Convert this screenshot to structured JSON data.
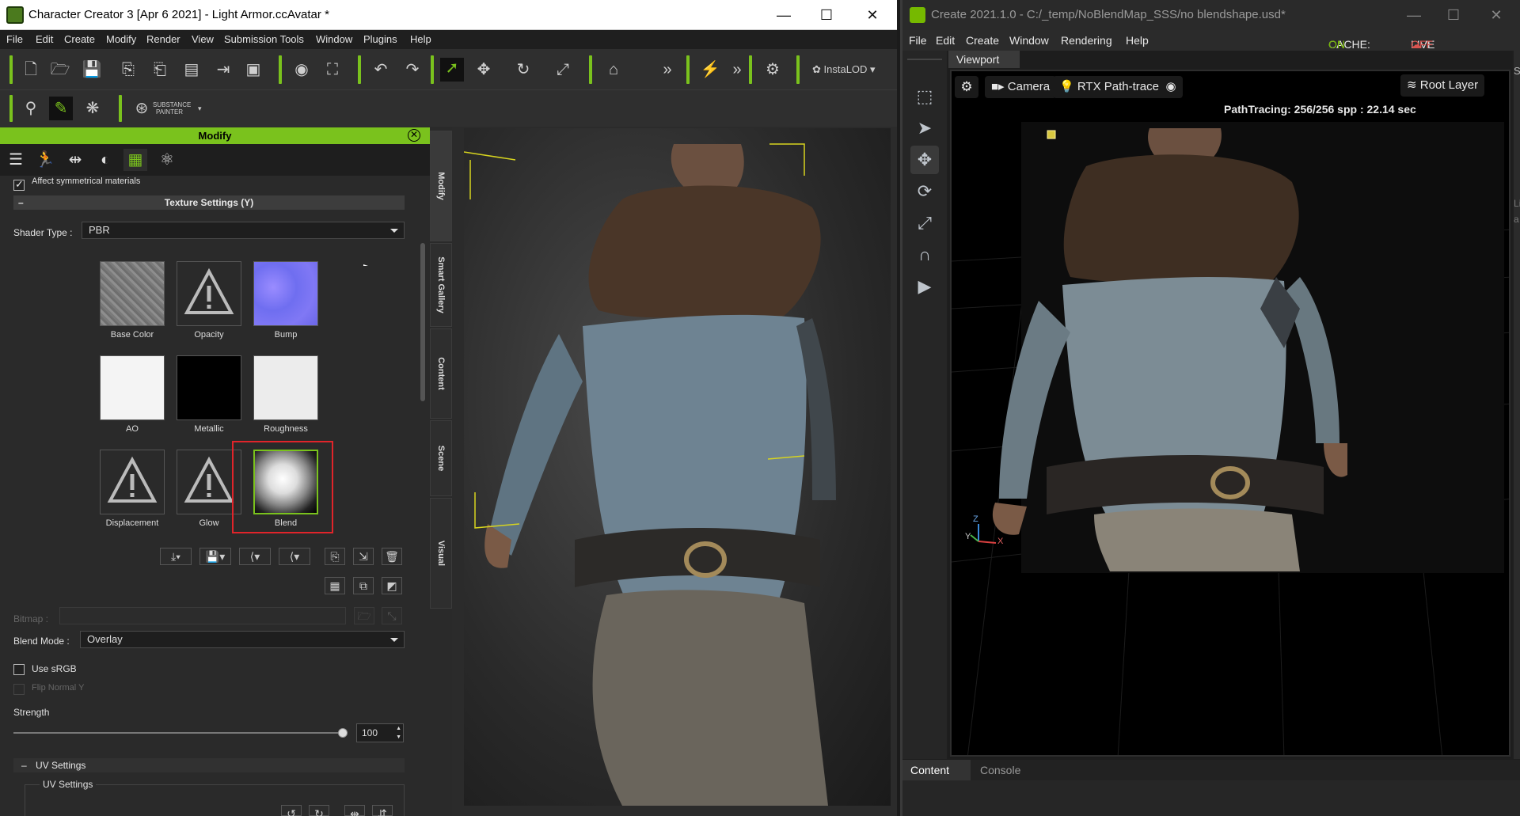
{
  "cc": {
    "title": "Character Creator 3 [Apr  6 2021] - Light Armor.ccAvatar *",
    "menu": [
      "File",
      "Edit",
      "Create",
      "Modify",
      "Render",
      "View",
      "Submission Tools",
      "Window",
      "Plugins",
      "Help"
    ],
    "instalod_label": "InstaLOD",
    "substance_label_1": "SUBSTANCE",
    "substance_label_2": "PAINTER",
    "panel_title": "Modify",
    "affect_symmetrical": "Affect symmetrical materials",
    "texture_settings": "Texture Settings  (Y)",
    "texture_settings_toggle": "–",
    "shader_type_label": "Shader Type :",
    "shader_type_value": "PBR",
    "textures": [
      "Base Color",
      "Opacity",
      "Bump",
      "AO",
      "Metallic",
      "Roughness",
      "Displacement",
      "Glow",
      "Blend"
    ],
    "bitmap_label": "Bitmap :",
    "blend_mode_label": "Blend Mode :",
    "blend_mode_value": "Overlay",
    "use_srgb": "Use sRGB",
    "flip_normal_y": "Flip Normal Y",
    "strength_label": "Strength",
    "strength_value": "100",
    "strength_fraction": 1.0,
    "uv_settings_header": "UV Settings",
    "uv_settings_group": "UV Settings",
    "uv_toggle": "–",
    "vtabs": [
      "Modify",
      "Smart Gallery",
      "Content",
      "Scene",
      "Visual"
    ]
  },
  "ov": {
    "title": "Create 2021.1.0 - C:/_temp/NoBlendMap_SSS/no blendshape.usd*",
    "menu": [
      "File",
      "Edit",
      "Create",
      "Window",
      "Rendering",
      "Help"
    ],
    "cache_label": "CACHE:",
    "cache_value": "ON",
    "live_sync_label": "LIVE SYNC:",
    "live_sync_value": "OFF",
    "viewport_tab": "Viewport",
    "camera_label": "Camera",
    "render_mode": "RTX Path-traced",
    "root_layer": "Root Layer",
    "pathtracing_status": "PathTracing: 256/256 spp : 22.14 sec",
    "axis_z": "Z",
    "axis_y": "Y",
    "axis_x": "X",
    "bottom_tabs": [
      "Content",
      "Console"
    ],
    "right_edge_label_1": "Se",
    "right_edge_label_2": "Lig",
    "right_edge_label_3": "a"
  },
  "colors": {
    "accent_green": "#7ac21d",
    "highlight_red": "#e0242a",
    "on_green": "#76b900",
    "off_red": "#d9534f"
  }
}
